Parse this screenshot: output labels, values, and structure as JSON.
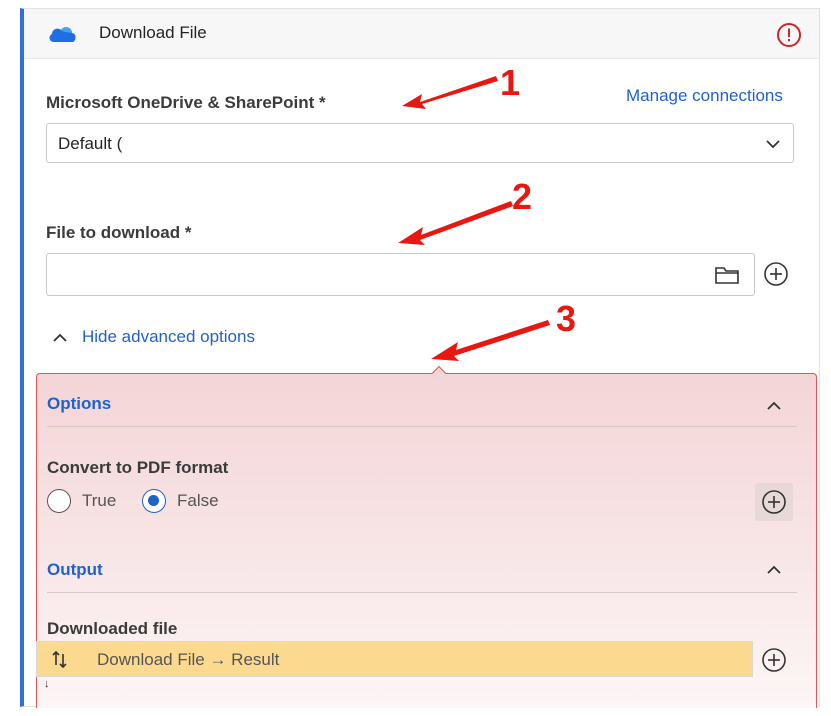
{
  "header": {
    "title": "Download File"
  },
  "connection": {
    "label": "Microsoft OneDrive & SharePoint *",
    "manage_link": "Manage connections",
    "selected_value": "Default (                                              com)"
  },
  "file": {
    "label": "File to download *"
  },
  "advanced": {
    "toggle_label": "Hide advanced options"
  },
  "options": {
    "title": "Options",
    "convert_label": "Convert to PDF format",
    "radio_true": "True",
    "radio_false": "False",
    "selected": "False"
  },
  "output": {
    "title": "Output",
    "downloaded_label": "Downloaded file",
    "value": "Download File → Result"
  },
  "annotations": {
    "n1": "1",
    "n2": "2",
    "n3": "3"
  },
  "colors": {
    "accent": "#2f6fd8",
    "link": "#1f62c8",
    "warning": "#c62828",
    "annotation_red": "#e8170f",
    "highlight_bg": "#f4d5d7",
    "output_bg": "#fbd98e"
  }
}
